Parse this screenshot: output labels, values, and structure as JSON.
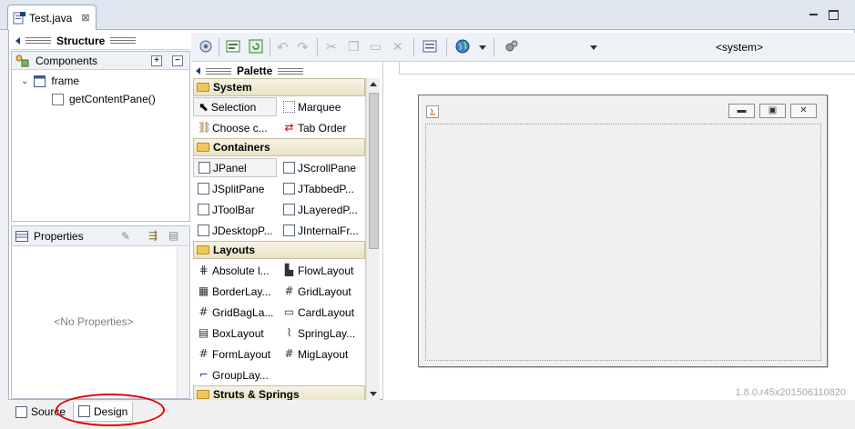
{
  "editor_tab": {
    "label": "Test.java",
    "icon": "java-file-icon",
    "close_icon": "close-icon"
  },
  "structure": {
    "title": "Structure",
    "components": {
      "title": "Components",
      "tree": [
        {
          "label": "frame",
          "icon": "frame-icon"
        },
        {
          "label": "getContentPane()",
          "icon": "panel-icon"
        }
      ]
    },
    "properties": {
      "title": "Properties",
      "empty_text": "<No Properties>"
    }
  },
  "toolbar": {
    "system_label": "<system>"
  },
  "palette": {
    "title": "Palette",
    "categories": [
      {
        "name": "System",
        "items": [
          "Selection",
          "Marquee",
          "Choose c...",
          "Tab Order"
        ]
      },
      {
        "name": "Containers",
        "items": [
          "JPanel",
          "JScrollPane",
          "JSplitPane",
          "JTabbedP...",
          "JToolBar",
          "JLayeredP...",
          "JDesktopP...",
          "JInternalFr..."
        ]
      },
      {
        "name": "Layouts",
        "items": [
          "Absolute l...",
          "FlowLayout",
          "BorderLay...",
          "GridLayout",
          "GridBagLa...",
          "CardLayout",
          "BoxLayout",
          "SpringLay...",
          "FormLayout",
          "MigLayout",
          "GroupLay..."
        ]
      },
      {
        "name": "Struts & Springs",
        "items": []
      }
    ]
  },
  "canvas": {
    "version": "1.8.0.r45x201506110820"
  },
  "bottom_tabs": [
    {
      "label": "Source",
      "icon": "source-icon"
    },
    {
      "label": "Design",
      "icon": "design-icon"
    }
  ],
  "colors": {
    "annotation": "#e00000",
    "palette_category": "#efe9d2",
    "selected_tab": "#ffffff"
  }
}
